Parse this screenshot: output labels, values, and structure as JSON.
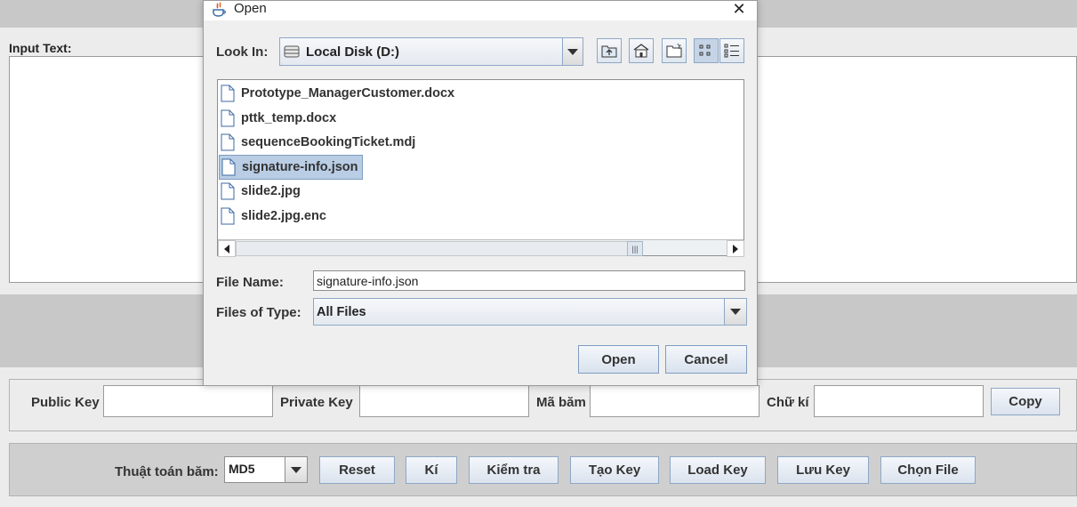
{
  "app": {
    "input_label": "Input Text:",
    "public_key_label": "Public Key",
    "private_key_label": "Private Key",
    "hash_label": "Mã băm",
    "signature_label": "Chữ kí",
    "copy_button": "Copy",
    "hash_algo_label": "Thuật toán băm:",
    "hash_algo_value": "MD5",
    "buttons": {
      "reset": "Reset",
      "sign": "Kí",
      "verify": "Kiểm tra",
      "create_key": "Tạo Key",
      "load_key": "Load Key",
      "save_key": "Lưu Key",
      "choose_file": "Chọn File"
    }
  },
  "dialog": {
    "title": "Open",
    "look_in_label": "Look In:",
    "look_in_value": "Local Disk (D:)",
    "files": [
      {
        "name": "Prototype_ManagerCustomer.docx",
        "selected": false
      },
      {
        "name": "pttk_temp.docx",
        "selected": false
      },
      {
        "name": "sequenceBookingTicket.mdj",
        "selected": false
      },
      {
        "name": "signature-info.json",
        "selected": true
      },
      {
        "name": "slide2.jpg",
        "selected": false
      },
      {
        "name": "slide2.jpg.enc",
        "selected": false
      }
    ],
    "file_name_label": "File Name:",
    "file_name_value": "signature-info.json",
    "file_type_label": "Files of Type:",
    "file_type_value": "All Files",
    "open_button": "Open",
    "cancel_button": "Cancel"
  },
  "colors": {
    "selection": "#b9cde5",
    "button_border": "#8ea7c6",
    "background": "#ececec"
  }
}
